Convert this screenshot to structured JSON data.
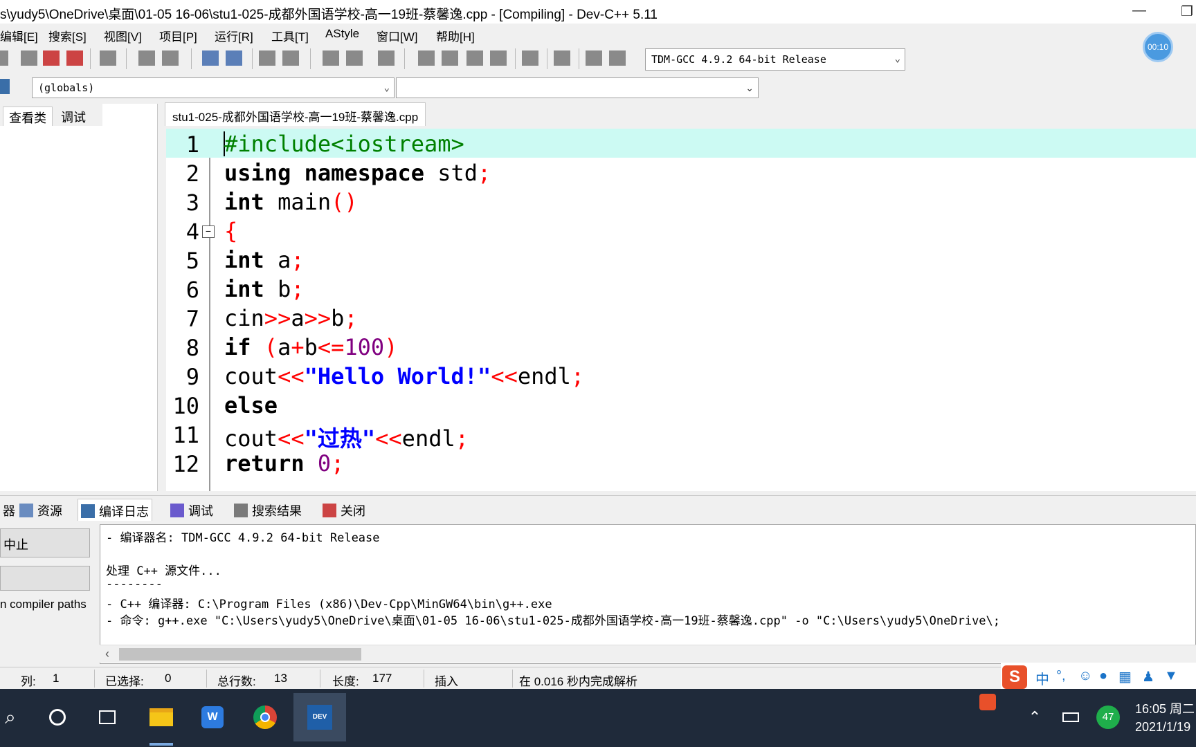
{
  "window": {
    "title": "s\\yudy5\\OneDrive\\桌面\\01-05 16-06\\stu1-025-成都外国语学校-高一19班-蔡馨逸.cpp - [Compiling] - Dev-C++ 5.11",
    "minimize": "—",
    "restore": "❐"
  },
  "menu": [
    "编辑[E]",
    "搜索[S]",
    "视图[V]",
    "项目[P]",
    "运行[R]",
    "工具[T]",
    "AStyle",
    "窗口[W]",
    "帮助[H]"
  ],
  "timer": "00:10",
  "toolbar": {
    "compiler": "TDM-GCC 4.9.2 64-bit Release",
    "scope": "(globals)"
  },
  "left_tabs": [
    "查看类",
    "调试"
  ],
  "editor": {
    "tab": "stu1-025-成都外国语学校-高一19班-蔡馨逸.cpp",
    "lines": [
      "#include<iostream>",
      "using namespace std;",
      "int main()",
      "{",
      "int a;",
      "int b;",
      "cin>>a>>b;",
      "if (a+b<=100)",
      "cout<<\"Hello World!\"<<endl;",
      "else",
      "cout<<\"过热\"<<endl;",
      "return 0;"
    ],
    "line_numbers": [
      "1",
      "2",
      "3",
      "4",
      "5",
      "6",
      "7",
      "8",
      "9",
      "10",
      "11",
      "12"
    ]
  },
  "bottom_tabs": [
    "器",
    "资源",
    "编译日志",
    "调试",
    "搜索结果",
    "关闭"
  ],
  "compile_panel": {
    "abort_button": "中止",
    "compiler_paths": "n compiler paths",
    "log": [
      "- 编译器名: TDM-GCC 4.9.2 64-bit Release",
      "",
      "处理 C++ 源文件...",
      "--------",
      "- C++ 编译器: C:\\Program Files (x86)\\Dev-Cpp\\MinGW64\\bin\\g++.exe",
      "- 命令: g++.exe \"C:\\Users\\yudy5\\OneDrive\\桌面\\01-05 16-06\\stu1-025-成都外国语学校-高一19班-蔡馨逸.cpp\" -o \"C:\\Users\\yudy5\\OneDrive\\;"
    ]
  },
  "status": {
    "col_label": "列:",
    "col_value": "1",
    "selected_label": "已选择:",
    "selected_value": "0",
    "lines_label": "总行数:",
    "lines_value": "13",
    "length_label": "长度:",
    "length_value": "177",
    "mode": "插入",
    "parse": "在 0.016 秒内完成解析"
  },
  "ime": {
    "lang": "中",
    "punct": "°,"
  },
  "taskbar": {
    "badge": "47",
    "time": "16:05 周二",
    "date": "2021/1/19"
  }
}
